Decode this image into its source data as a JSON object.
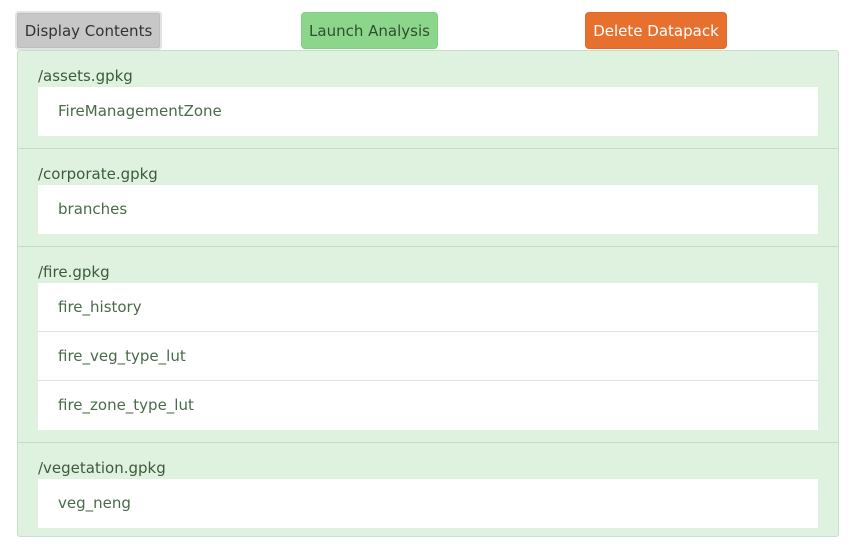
{
  "toolbar": {
    "display_label": "Display Contents",
    "launch_label": "Launch Analysis",
    "delete_label": "Delete Datapack"
  },
  "colors": {
    "panel_bg": "#dff2df",
    "launch_bg": "#8cd68c",
    "delete_bg": "#e8702f",
    "display_bg": "#c7c7c7"
  },
  "packages": [
    {
      "name": "/assets.gpkg",
      "layers": [
        "FireManagementZone"
      ]
    },
    {
      "name": "/corporate.gpkg",
      "layers": [
        "branches"
      ]
    },
    {
      "name": "/fire.gpkg",
      "layers": [
        "fire_history",
        "fire_veg_type_lut",
        "fire_zone_type_lut"
      ]
    },
    {
      "name": "/vegetation.gpkg",
      "layers": [
        "veg_neng"
      ]
    }
  ]
}
